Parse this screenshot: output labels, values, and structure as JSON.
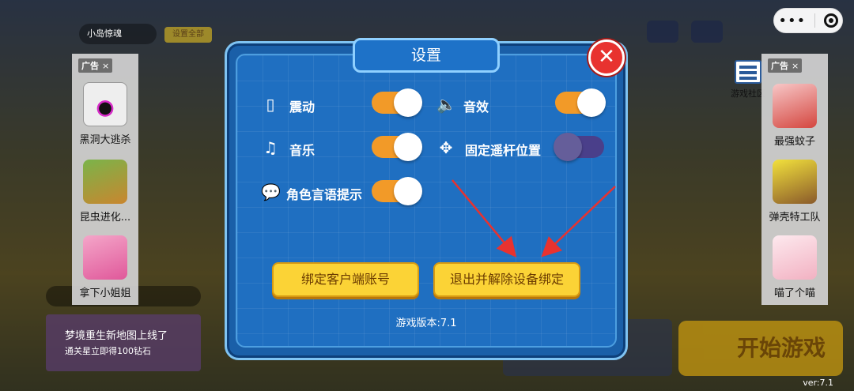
{
  "background": {
    "player_name": "小岛惊魂",
    "badge": "设置全部",
    "banner_line1": "梦境重生新地图上线了",
    "banner_line2": "通关星立即得100钻石",
    "start_button": "开始游戏",
    "version_corner": "ver:7.1",
    "community_label": "游戏社区"
  },
  "ad_left": {
    "header": "广告",
    "close": "×",
    "items": [
      {
        "label": "黑洞大逃杀"
      },
      {
        "label": "昆虫进化..."
      },
      {
        "label": "拿下小姐姐"
      }
    ]
  },
  "ad_right": {
    "header": "广告",
    "close": "×",
    "items": [
      {
        "label": "最强蚊子"
      },
      {
        "label": "弹壳特工队"
      },
      {
        "label": "喵了个喵"
      }
    ]
  },
  "dialog": {
    "title": "设置",
    "close": "✕",
    "settings": [
      {
        "label": "震动",
        "on": true
      },
      {
        "label": "音效",
        "on": true
      },
      {
        "label": "音乐",
        "on": true
      },
      {
        "label": "固定遥杆位置",
        "on": false
      },
      {
        "label": "角色言语提示",
        "on": true
      }
    ],
    "bind_button": "绑定客户端账号",
    "unbind_button": "退出并解除设备绑定",
    "version": "游戏版本:7.1"
  },
  "colors": {
    "toggle_on": "#f29a28",
    "toggle_off": "#4a3f8a",
    "button_yellow": "#fbd336",
    "close_red": "#e8322f",
    "dialog_blue": "#1f6fc1"
  }
}
